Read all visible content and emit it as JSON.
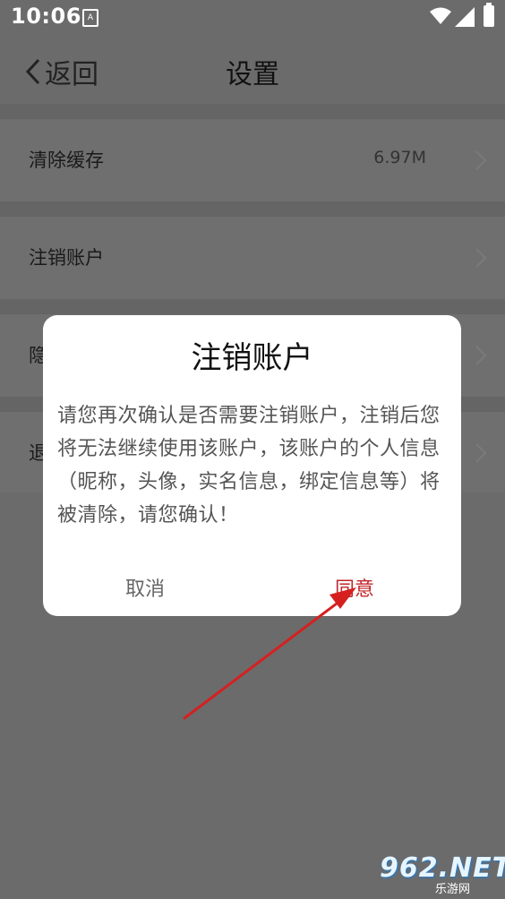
{
  "status_bar": {
    "time": "10:06",
    "notification_icon": "A"
  },
  "navbar": {
    "back_label": "返回",
    "title": "设置"
  },
  "settings": {
    "items": [
      {
        "label": "清除缓存",
        "value": "6.97M"
      },
      {
        "label": "注销账户",
        "value": ""
      },
      {
        "label": "隐",
        "value": ""
      },
      {
        "label": "退",
        "value": ""
      }
    ]
  },
  "dialog": {
    "title": "注销账户",
    "body": "请您再次确认是否需要注销账户，注销后您将无法继续使用该账户，该账户的个人信息（昵称，头像，实名信息，绑定信息等）将被清除，请您确认！",
    "cancel_label": "取消",
    "agree_label": "同意"
  },
  "watermark": {
    "main": "962.NET",
    "sub": "乐游网"
  },
  "colors": {
    "accent_red": "#c0262a",
    "overlay": "#6b6b6b",
    "annotation_arrow": "#d62020"
  }
}
